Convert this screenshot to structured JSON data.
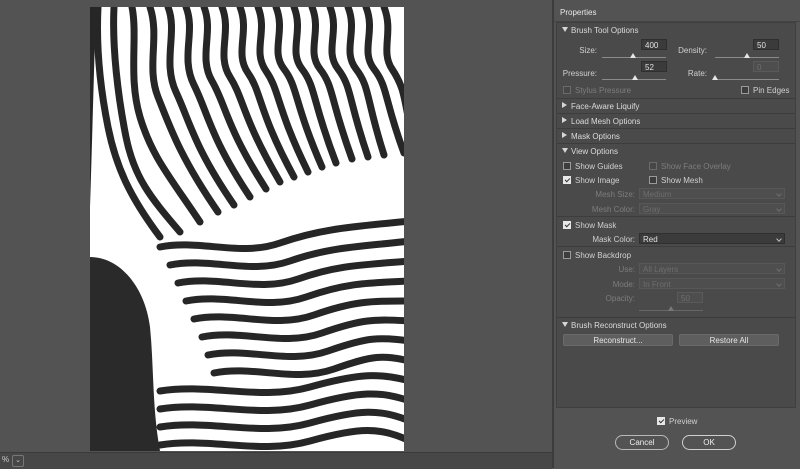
{
  "status": {
    "zoom": "%",
    "zoom_arrow": "⌄"
  },
  "panel": {
    "title": "Properties",
    "brush_tool": {
      "title": "Brush Tool Options",
      "size_label": "Size:",
      "size_value": "400",
      "size_level": 0.48,
      "density_label": "Density:",
      "density_value": "50",
      "density_level": 0.5,
      "pressure_label": "Pressure:",
      "pressure_value": "52",
      "pressure_level": 0.52,
      "rate_label": "Rate:",
      "rate_value": "0",
      "rate_level": 0.0,
      "stylus_label": "Stylus Pressure",
      "pin_edges_label": "Pin Edges"
    },
    "face_aware": {
      "title": "Face-Aware Liquify"
    },
    "load_mesh": {
      "title": "Load Mesh Options"
    },
    "mask": {
      "title": "Mask Options"
    },
    "view": {
      "title": "View Options",
      "show_guides": "Show Guides",
      "show_face_overlay": "Show Face Overlay",
      "show_image": "Show Image",
      "show_mesh": "Show Mesh",
      "mesh_size_label": "Mesh Size:",
      "mesh_size_value": "Medium",
      "mesh_color_label": "Mesh Color:",
      "mesh_color_value": "Gray",
      "show_mask": "Show Mask",
      "mask_color_label": "Mask Color:",
      "mask_color_value": "Red",
      "show_backdrop": "Show Backdrop",
      "use_label": "Use:",
      "use_value": "All Layers",
      "mode_label": "Mode:",
      "mode_value": "In Front",
      "opacity_label": "Opacity:",
      "opacity_value": "50",
      "opacity_level": 0.5
    },
    "reconstruct": {
      "title": "Brush Reconstruct Options",
      "reconstruct_btn": "Reconstruct...",
      "restore_btn": "Restore All"
    },
    "preview_label": "Preview",
    "cancel_label": "Cancel",
    "ok_label": "OK"
  },
  "colors": {
    "panel_bg": "#535353",
    "section_bg": "#4a4a4a",
    "stripe": "#262626"
  }
}
